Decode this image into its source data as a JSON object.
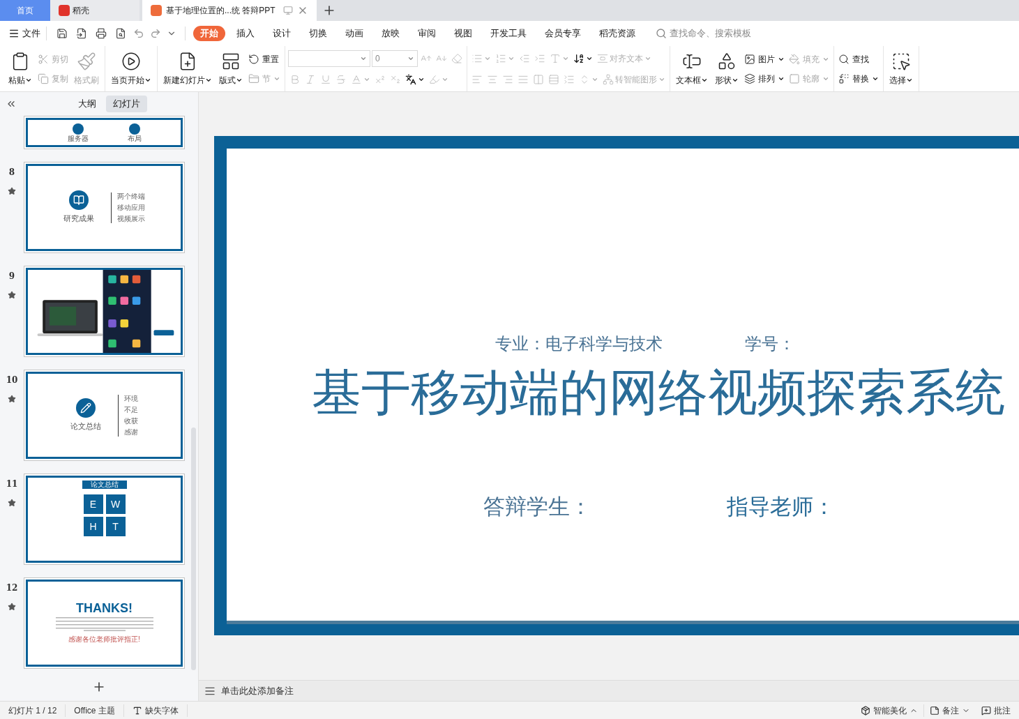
{
  "tabs": [
    {
      "label": "首页",
      "kind": "home",
      "selected": false
    },
    {
      "label": "稻壳",
      "kind": "docer",
      "selected": false
    },
    {
      "label": "基于地理位置的...统 答辩PPT",
      "kind": "document",
      "selected": true
    }
  ],
  "menu": {
    "file": "文件",
    "tabs": [
      {
        "label": "开始",
        "selected": true
      },
      {
        "label": "插入",
        "selected": false
      },
      {
        "label": "设计",
        "selected": false
      },
      {
        "label": "切换",
        "selected": false
      },
      {
        "label": "动画",
        "selected": false
      },
      {
        "label": "放映",
        "selected": false
      },
      {
        "label": "审阅",
        "selected": false
      },
      {
        "label": "视图",
        "selected": false
      },
      {
        "label": "开发工具",
        "selected": false
      },
      {
        "label": "会员专享",
        "selected": false
      },
      {
        "label": "稻壳资源",
        "selected": false
      }
    ],
    "search": {
      "placeholder": "查找命令、搜索模板"
    }
  },
  "ribbon": [
    {
      "columns": [
        {
          "kind": "large",
          "items": [
            {
              "label": "粘贴",
              "dropdown": true,
              "disabled": false
            }
          ]
        },
        {
          "kind": "small",
          "items": [
            {
              "label": "剪切",
              "disabled": true
            },
            {
              "label": "复制",
              "disabled": true
            }
          ]
        },
        {
          "kind": "large",
          "items": [
            {
              "label": "格式刷",
              "disabled": true
            }
          ]
        }
      ]
    },
    {
      "columns": [
        {
          "kind": "large",
          "items": [
            {
              "label": "当页开始",
              "dropdown": true,
              "disabled": false
            }
          ]
        }
      ]
    },
    {
      "columns": [
        {
          "kind": "large",
          "items": [
            {
              "label": "新建幻灯片",
              "dropdown": true,
              "disabled": false
            }
          ]
        },
        {
          "kind": "large",
          "items": [
            {
              "label": "版式",
              "dropdown": true,
              "disabled": false
            }
          ]
        },
        {
          "kind": "small",
          "items": [
            {
              "label": "重置",
              "disabled": false
            },
            {
              "label": "节",
              "dropdown": true,
              "disabled": true
            }
          ]
        }
      ]
    },
    {
      "columns": [
        {
          "kind": "rows",
          "rows": [
            [
              {
                "kind": "font-field"
              },
              {
                "kind": "size-field",
                "value": "0"
              },
              {
                "disabled": true
              },
              {
                "disabled": true
              },
              {
                "disabled": true
              }
            ],
            [
              {
                "disabled": true
              },
              {
                "disabled": true
              },
              {
                "disabled": true
              },
              {
                "disabled": true
              },
              {
                "disabled": true,
                "dropdown": true
              },
              {
                "disabled": true
              },
              {
                "disabled": true
              },
              {
                "disabled": false,
                "dropdown": true
              },
              {
                "disabled": true,
                "dropdown": true
              }
            ]
          ]
        }
      ]
    },
    {
      "columns": [
        {
          "kind": "rows",
          "rows": [
            [
              {
                "disabled": true,
                "dropdown": true
              },
              {
                "disabled": true,
                "dropdown": true
              },
              {
                "disabled": true
              },
              {
                "disabled": true
              },
              {
                "disabled": true,
                "dropdown": true
              },
              {
                "disabled": false,
                "dropdown": true
              },
              {
                "label": "对齐文本",
                "disabled": true,
                "dropdown": true
              }
            ],
            [
              {
                "disabled": true
              },
              {
                "disabled": true
              },
              {
                "disabled": true
              },
              {
                "disabled": true
              },
              {
                "disabled": true
              },
              {
                "disabled": true
              },
              {
                "disabled": true
              },
              {
                "disabled": true,
                "dropdown": true
              },
              {
                "label": "转智能图形",
                "disabled": true,
                "dropdown": true
              }
            ]
          ]
        }
      ]
    },
    {
      "columns": [
        {
          "kind": "large",
          "items": [
            {
              "label": "文本框",
              "dropdown": true,
              "disabled": false
            }
          ]
        },
        {
          "kind": "large",
          "items": [
            {
              "label": "形状",
              "dropdown": true,
              "disabled": false
            }
          ]
        },
        {
          "kind": "small",
          "items": [
            {
              "label": "图片",
              "dropdown": true,
              "disabled": false
            },
            {
              "label": "排列",
              "dropdown": true,
              "disabled": false
            }
          ]
        },
        {
          "kind": "small",
          "items": [
            {
              "label": "填充",
              "dropdown": true,
              "disabled": true
            },
            {
              "label": "轮廓",
              "dropdown": true,
              "disabled": true
            }
          ]
        }
      ]
    },
    {
      "columns": [
        {
          "kind": "small",
          "items": [
            {
              "label": "查找",
              "disabled": false
            },
            {
              "label": "替换",
              "dropdown": true,
              "disabled": false
            }
          ]
        }
      ]
    },
    {
      "columns": [
        {
          "kind": "large",
          "items": [
            {
              "label": "选择",
              "dropdown": true,
              "disabled": false
            }
          ]
        }
      ]
    }
  ],
  "panel": {
    "tabs": [
      {
        "label": "大纲",
        "selected": false
      },
      {
        "label": "幻灯片",
        "selected": true
      }
    ],
    "slides": [
      {
        "kind": "services",
        "labels": [
          "服务器",
          "布局"
        ]
      },
      {
        "number": "8",
        "kind": "timeline",
        "heading": "研究成果",
        "items": [
          "两个终端",
          "移动应用",
          "视频展示"
        ],
        "animated": true
      },
      {
        "number": "9",
        "kind": "picture",
        "animated": true
      },
      {
        "number": "10",
        "kind": "timeline",
        "heading": "论文总结",
        "items": [
          "环境",
          "不足",
          "收获",
          "感谢"
        ],
        "animated": true
      },
      {
        "number": "11",
        "kind": "matrix",
        "heading": "论文总结",
        "letters": [
          "E",
          "W",
          "H",
          "T"
        ],
        "animated": true
      },
      {
        "number": "12",
        "kind": "thanks",
        "heading": "THANKS!",
        "footer": "感谢各位老师批评指正!",
        "animated": true
      }
    ]
  },
  "slide": {
    "major": "专业：电子科学与技术",
    "student_id": "学号：",
    "title": "基于移动端的网络视频探索系统",
    "student": "答辩学生：",
    "advisor": "指导老师："
  },
  "notes": {
    "placeholder": "单击此处添加备注"
  },
  "status_bar": {
    "slide": "幻灯片 1 / 12",
    "theme": "Office 主题",
    "missing_fonts": "缺失字体",
    "beautify": "智能美化",
    "notes": "备注",
    "comments": "批注"
  }
}
